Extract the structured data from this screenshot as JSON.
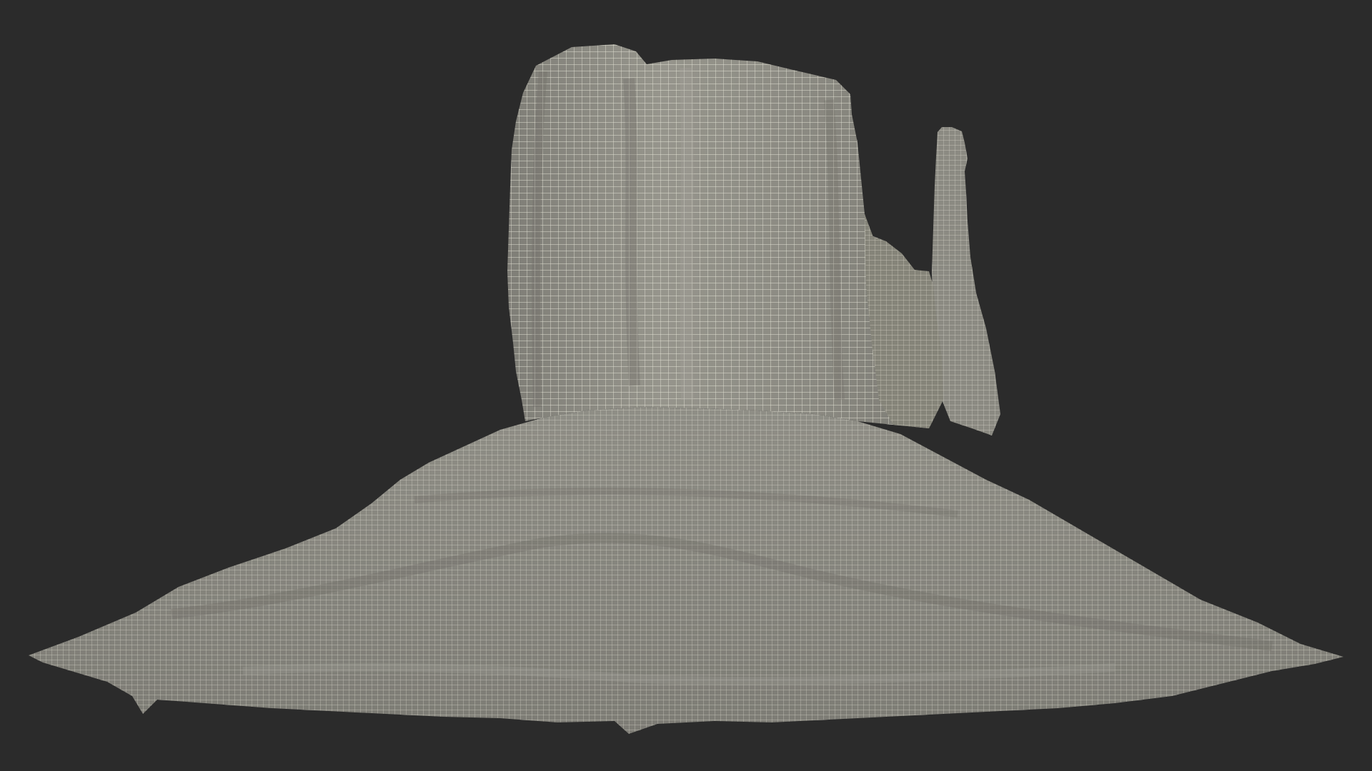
{
  "scene": {
    "subject": "mitten-butte-rock-formation",
    "render_mode": "wireframe",
    "colors": {
      "background": "#2b2b2b",
      "surface": "#8d8c84",
      "surface_light": "#a4a39a",
      "surface_dark": "#6f6e67",
      "wire": "#f1f0e2"
    }
  }
}
